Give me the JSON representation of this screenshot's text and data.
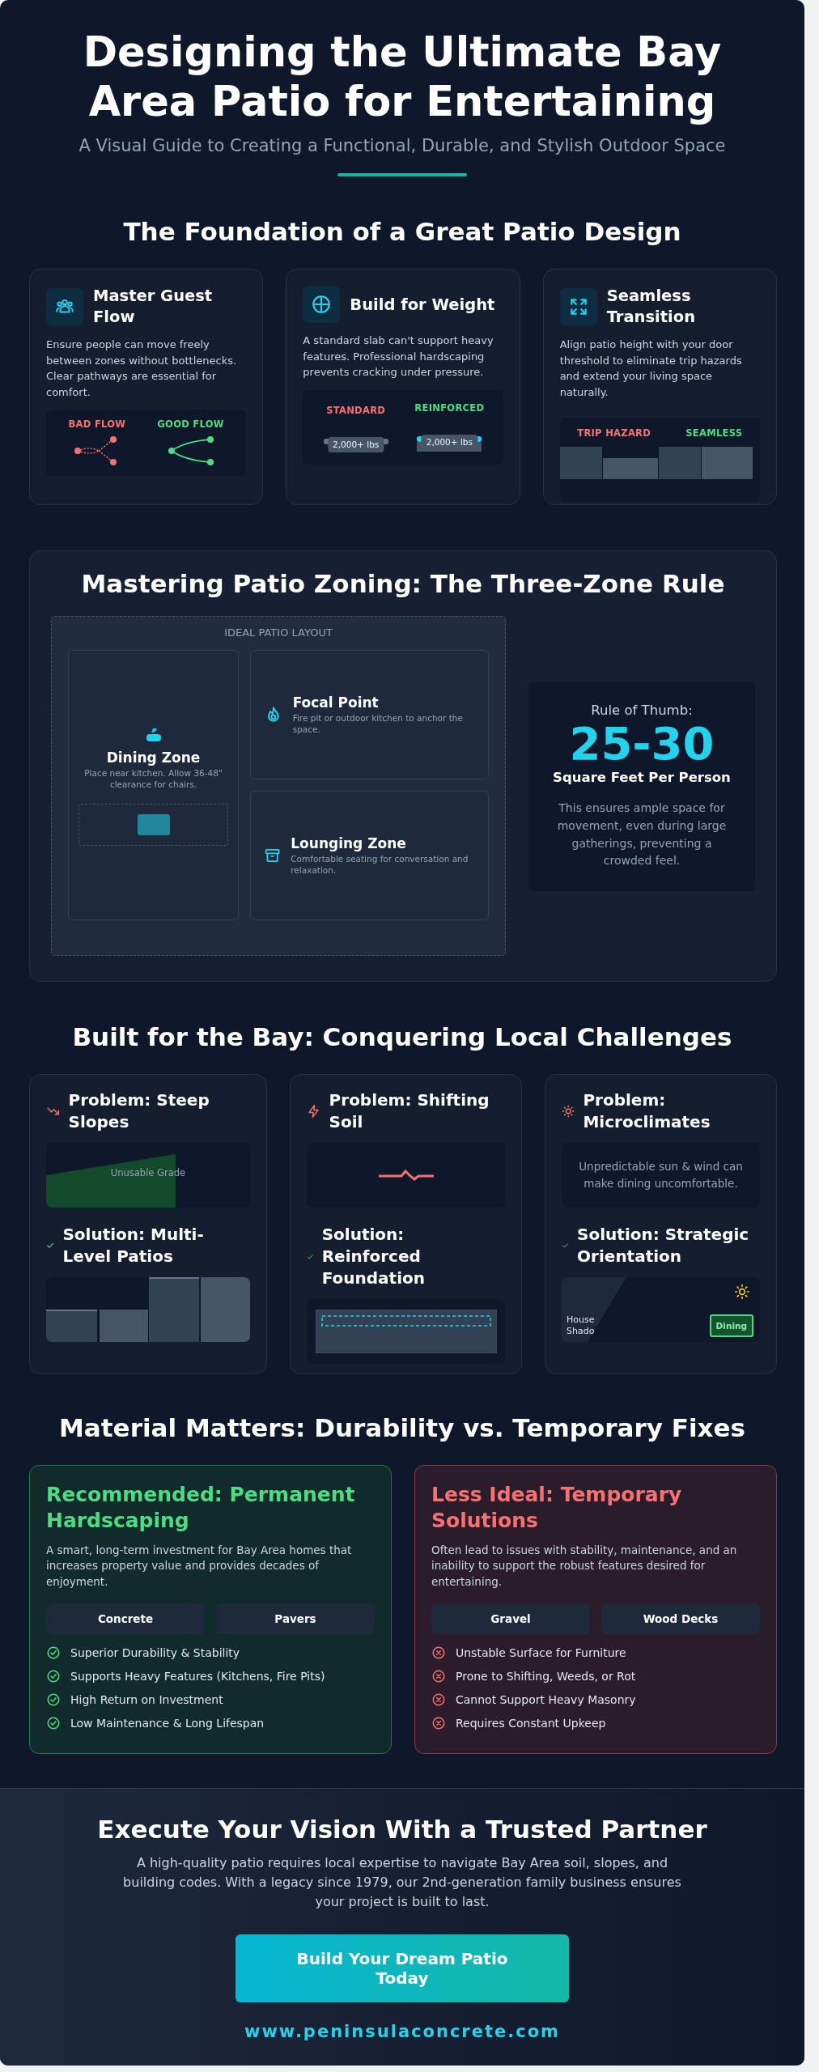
{
  "header": {
    "title": "Designing the Ultimate Bay Area Patio for Entertaining",
    "subtitle": "A Visual Guide to Creating a Functional, Durable, and Stylish Outdoor Space"
  },
  "foundation": {
    "heading": "The Foundation of a Great Patio Design",
    "cards": [
      {
        "kind": "flow",
        "title": "Master Guest Flow",
        "text": "Ensure people can move freely between zones without bottlenecks. Clear pathways are essential for comfort.",
        "labels": [
          "BAD FLOW",
          "GOOD FLOW"
        ]
      },
      {
        "kind": "weight",
        "title": "Build for Weight",
        "text": "A standard slab can't support heavy features. Professional hardscaping prevents cracking under pressure.",
        "labels": [
          "STANDARD",
          "REINFORCED"
        ],
        "badges": [
          "2,000+ lbs",
          "2,000+ lbs"
        ]
      },
      {
        "kind": "transition",
        "title": "Seamless Transition",
        "text": "Align patio height with your door threshold to eliminate trip hazards and extend your living space naturally.",
        "labels": [
          "TRIP HAZARD",
          "SEAMLESS"
        ]
      }
    ]
  },
  "zoning": {
    "heading": "Mastering Patio Zoning: The Three-Zone Rule",
    "layout_label": "IDEAL PATIO LAYOUT",
    "zones": [
      {
        "kind": "dining",
        "title": "Dining Zone",
        "text": "Place near kitchen. Allow 36-48\" clearance for chairs."
      },
      {
        "kind": "focal",
        "title": "Focal Point",
        "text": "Fire pit or outdoor kitchen to anchor the space."
      },
      {
        "kind": "lounging",
        "title": "Lounging Zone",
        "text": "Comfortable seating for conversation and relaxation."
      }
    ],
    "rule": {
      "label": "Rule of Thumb:",
      "value": "25-30",
      "unit": "Square Feet Per Person",
      "text": "This ensures ample space for movement, even during large gatherings, preventing a crowded feel."
    }
  },
  "challenges": {
    "heading": "Built for the Bay: Conquering Local Challenges",
    "cards": [
      {
        "kind": "slopes",
        "problem": "Problem: Steep Slopes",
        "problem_note": "Unusable Grade",
        "solution": "Solution: Multi-Level Patios"
      },
      {
        "kind": "soil",
        "problem": "Problem: Shifting Soil",
        "solution": "Solution: Reinforced Foundation"
      },
      {
        "kind": "climate",
        "problem": "Problem: Microclimates",
        "problem_note": "Unpredictable sun & wind can make dining uncomfortable.",
        "solution": "Solution: Strategic Orientation",
        "shadow_label": "House Shado",
        "zone_label": "Dining"
      }
    ]
  },
  "materials": {
    "heading": "Material Matters: Durability vs. Temporary Fixes",
    "cards": [
      {
        "kind": "good",
        "title": "Recommended: Permanent Hardscaping",
        "text": "A smart, long-term investment for Bay Area homes that increases property value and provides decades of enjoyment.",
        "tags": [
          "Concrete",
          "Pavers"
        ],
        "points": [
          "Superior Durability & Stability",
          "Supports Heavy Features (Kitchens, Fire Pits)",
          "High Return on Investment",
          "Low Maintenance & Long Lifespan"
        ]
      },
      {
        "kind": "bad",
        "title": "Less Ideal: Temporary Solutions",
        "text": "Often lead to issues with stability, maintenance, and an inability to support the robust features desired for entertaining.",
        "tags": [
          "Gravel",
          "Wood Decks"
        ],
        "points": [
          "Unstable Surface for Furniture",
          "Prone to Shifting, Weeds, or Rot",
          "Cannot Support Heavy Masonry",
          "Requires Constant Upkeep"
        ]
      }
    ]
  },
  "cta": {
    "heading": "Execute Your Vision With a Trusted Partner",
    "text": "A high-quality patio requires local expertise to navigate Bay Area soil, slopes, and building codes. With a legacy since 1979, our 2nd-generation family business ensures your project is built to last.",
    "button": "Build Your Dream Patio Today",
    "url": "www.peninsulaconcrete.com"
  }
}
